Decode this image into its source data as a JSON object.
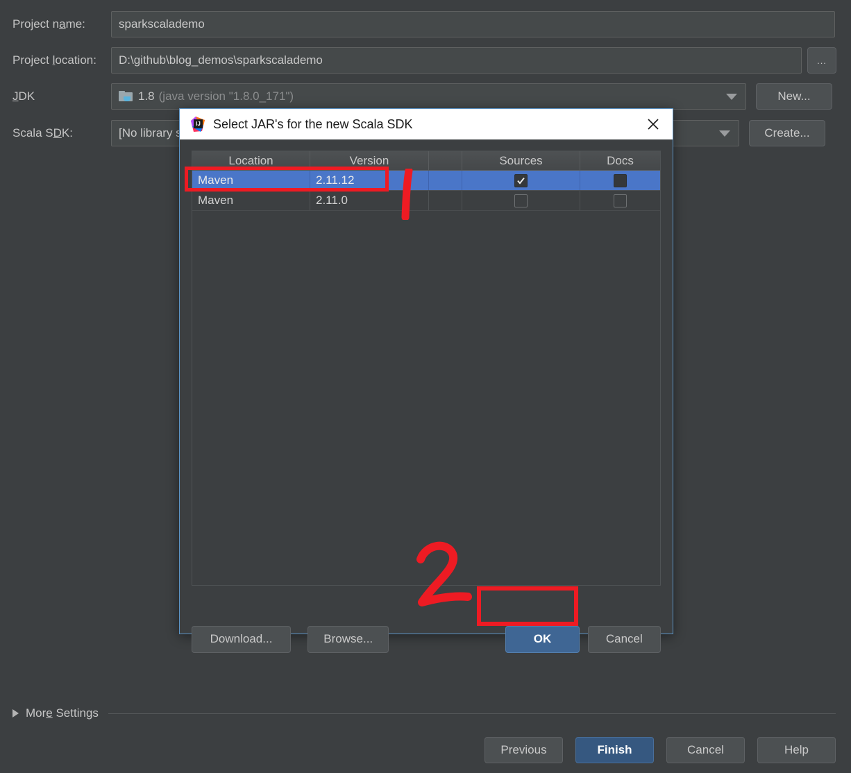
{
  "wizard": {
    "fields": [
      {
        "label_pre": "Project n",
        "label_accel": "a",
        "label_post": "me:",
        "value": "sparkscalademo"
      },
      {
        "label_pre": "Project ",
        "label_accel": "l",
        "label_post": "ocation:",
        "value": "D:\\github\\blog_demos\\sparkscalademo"
      },
      {
        "label_pre": "",
        "label_accel": "J",
        "label_post": "DK",
        "value": "1.8",
        "value_detail": "(java version \"1.8.0_171\")"
      },
      {
        "label_pre": "Scala S",
        "label_accel": "D",
        "label_post": "K:",
        "value": "[No library selected]"
      }
    ],
    "browse_button": "...",
    "new_button": "New...",
    "create_button": "Create...",
    "more_settings": "More Settings",
    "buttons": [
      {
        "label": "Previous",
        "primary": false
      },
      {
        "label": "Finish",
        "primary": true
      },
      {
        "label": "Cancel",
        "primary": false
      },
      {
        "label": "Help",
        "primary": false
      }
    ]
  },
  "dialog": {
    "title": "Select JAR's for the new Scala SDK",
    "close_label": "Close",
    "table": {
      "columns": [
        "Location",
        "Version",
        "",
        "Sources",
        "Docs"
      ],
      "rows": [
        {
          "location": "Maven",
          "version": "2.11.12",
          "sources": "checked",
          "docs": "filled",
          "selected": true
        },
        {
          "location": "Maven",
          "version": "2.11.0",
          "sources": "unchecked",
          "docs": "unchecked",
          "selected": false
        }
      ]
    },
    "buttons": {
      "download": "Download...",
      "browse": "Browse...",
      "ok": "OK",
      "cancel": "Cancel"
    }
  },
  "annotations": {
    "step_one": "1",
    "step_two": "2",
    "color": "#ee1b23"
  },
  "colors": {
    "background": "#3c3f41",
    "selection": "#4a76c8",
    "accent": "#365880",
    "dialog_border": "#5c94c6"
  }
}
